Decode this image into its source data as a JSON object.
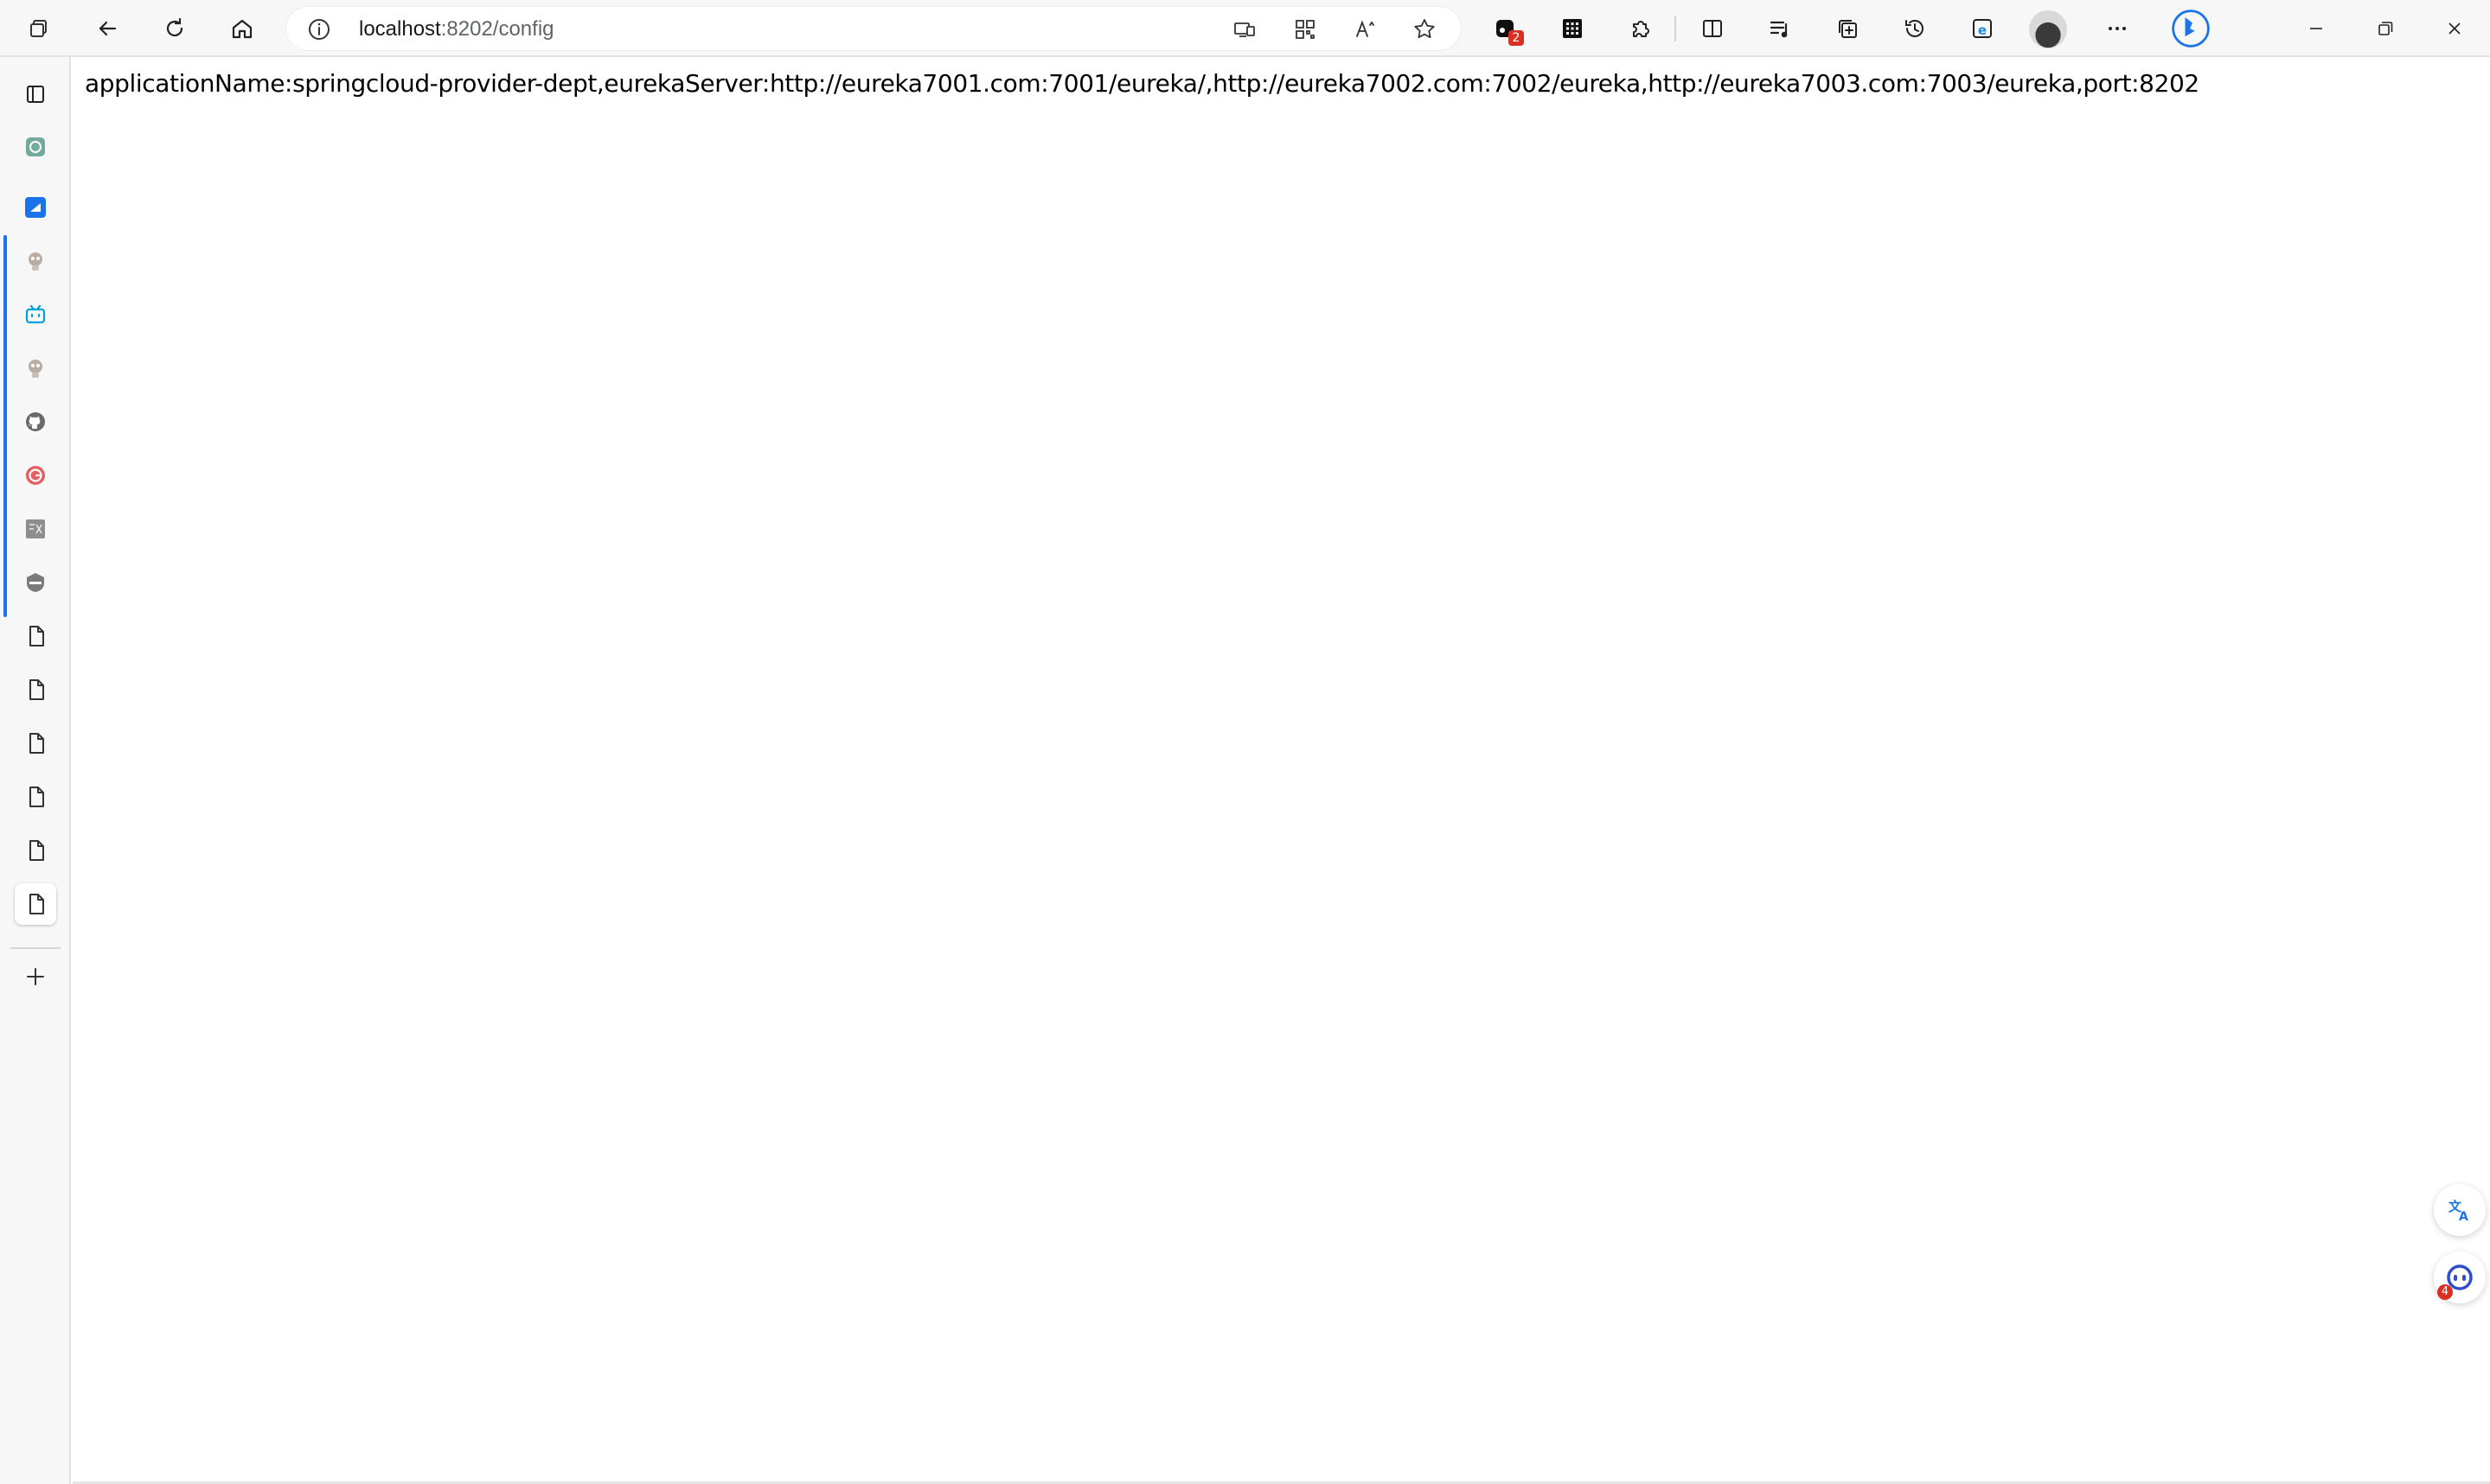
{
  "browser": {
    "address_host": "localhost",
    "address_rest": ":8202/config",
    "extension_badge": "2",
    "accent_color": "#1a73e8",
    "badge_color": "#d93025"
  },
  "sidebar": {
    "tabs": [
      {
        "icon": "tab-actions-icon"
      },
      {
        "icon": "chatgpt-icon"
      },
      {
        "icon": "blue-app-icon"
      },
      {
        "icon": "gopher-avatar-icon"
      },
      {
        "icon": "bilibili-icon"
      },
      {
        "icon": "gopher-avatar-icon"
      },
      {
        "icon": "github-icon"
      },
      {
        "icon": "gitee-icon"
      },
      {
        "icon": "grey-site-icon"
      },
      {
        "icon": "shield-icon"
      },
      {
        "icon": "page-icon"
      },
      {
        "icon": "page-icon"
      },
      {
        "icon": "page-icon"
      },
      {
        "icon": "page-icon"
      },
      {
        "icon": "page-icon"
      },
      {
        "icon": "page-icon"
      },
      {
        "icon": "new-tab-icon"
      }
    ]
  },
  "page": {
    "config_text": "applicationName:springcloud-provider-dept,eurekaServer:http://eureka7001.com:7001/eureka/,http://eureka7002.com:7002/eureka,http://eureka7003.com:7003/eureka,port:8202"
  },
  "floating": {
    "assistant_badge": "4"
  }
}
